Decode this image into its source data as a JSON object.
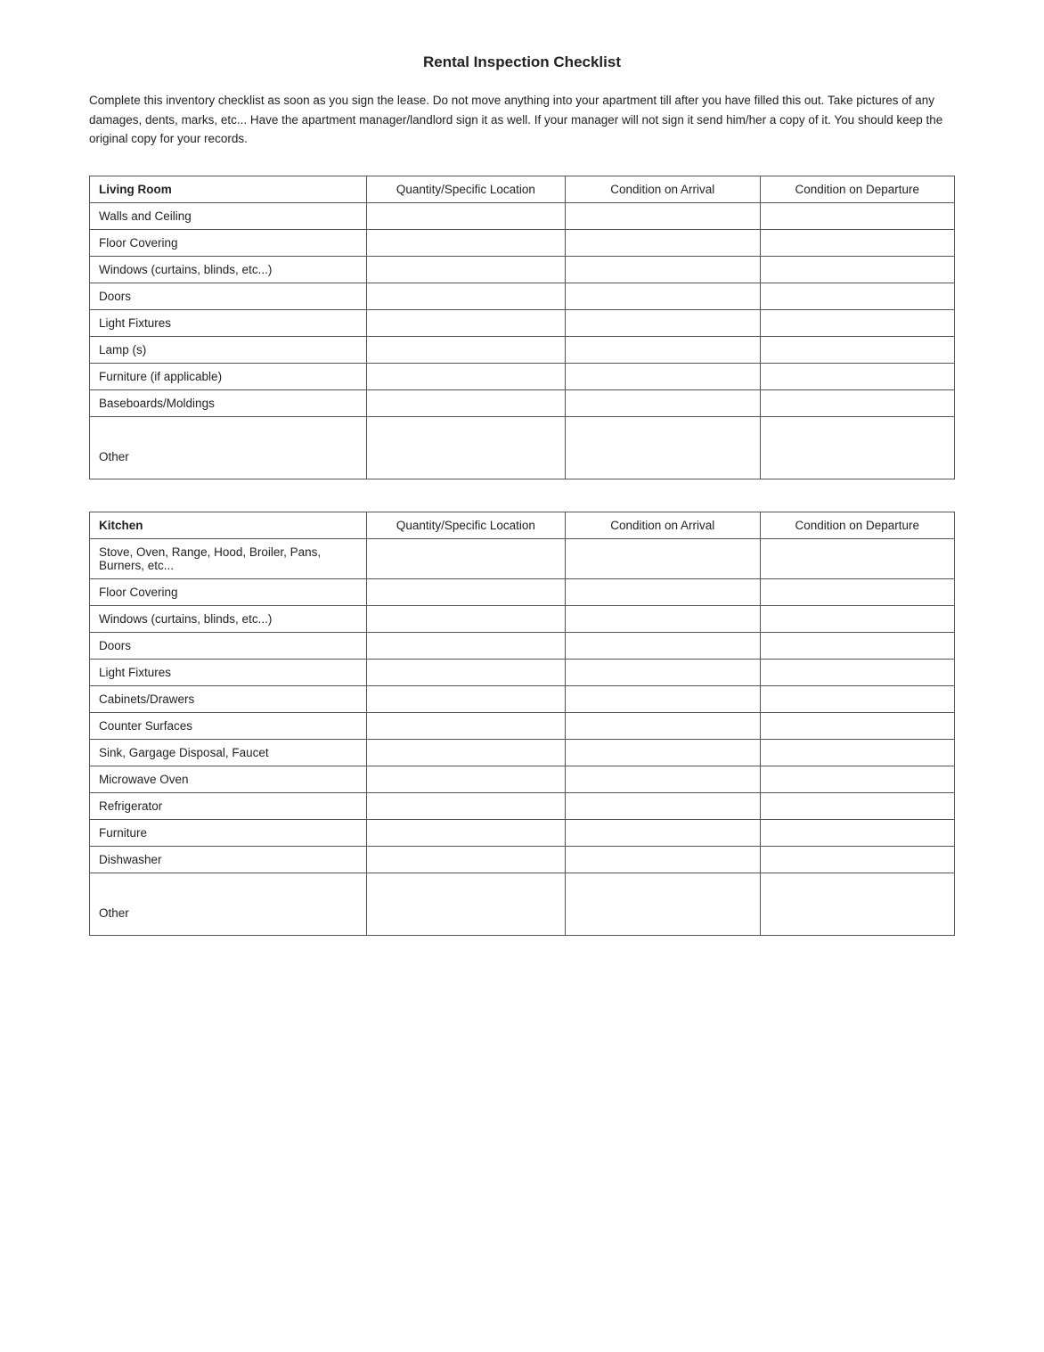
{
  "page": {
    "title": "Rental Inspection Checklist",
    "intro": "Complete this inventory checklist as soon as you sign the lease.  Do not move anything into your apartment till after you have filled this out.  Take pictures of any damages, dents, marks, etc... Have the apartment manager/landlord sign it as well.  If your manager will not sign it send him/her a copy of it. You should keep the original copy for your records."
  },
  "columns": {
    "qty": "Quantity/Specific Location",
    "arrival": "Condition on Arrival",
    "departure": "Condition on Departure"
  },
  "living_room": {
    "section_label": "Living Room",
    "items": [
      "Walls and Ceiling",
      "Floor Covering",
      "Windows (curtains, blinds, etc...)",
      "Doors",
      "Light Fixtures",
      "Lamp (s)",
      "Furniture (if applicable)",
      "Baseboards/Moldings",
      "Other"
    ]
  },
  "kitchen": {
    "section_label": "Kitchen",
    "items": [
      "Stove, Oven, Range, Hood, Broiler, Pans, Burners, etc...",
      "Floor Covering",
      "Windows (curtains, blinds, etc...)",
      "Doors",
      "Light Fixtures",
      "Cabinets/Drawers",
      "Counter Surfaces",
      "Sink, Gargage Disposal, Faucet",
      "Microwave Oven",
      "Refrigerator",
      "Furniture",
      "Dishwasher",
      "Other"
    ]
  }
}
